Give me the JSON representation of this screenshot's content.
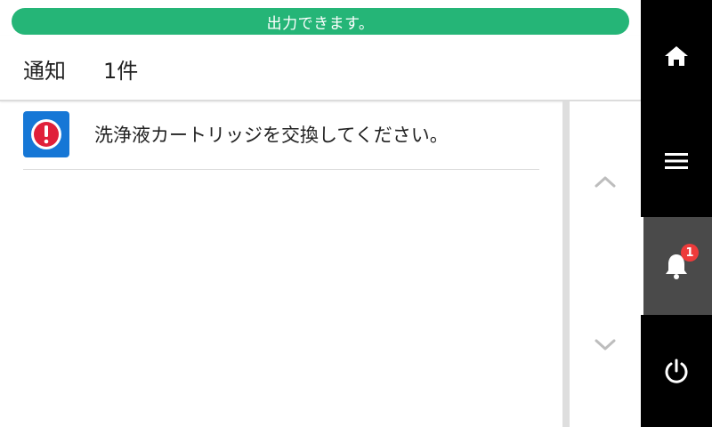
{
  "status": {
    "message": "出力できます。",
    "color": "#25b577"
  },
  "header": {
    "title": "通知",
    "count": "1件"
  },
  "notifications": [
    {
      "icon": "error-icon",
      "text": "洗浄液カートリッジを交換してください。"
    }
  ],
  "scroll": {
    "up_icon": "chevron-up-icon",
    "down_icon": "chevron-down-icon"
  },
  "sidebar": {
    "items": [
      {
        "icon": "home-icon"
      },
      {
        "icon": "menu-icon"
      },
      {
        "icon": "bell-icon",
        "badge": "1",
        "active": true
      },
      {
        "icon": "power-icon"
      }
    ]
  },
  "colors": {
    "accent": "#1677d6",
    "error": "#e0203a",
    "badge": "#ee3b3b",
    "sidebar": "#000000",
    "active": "#4a4a4a"
  }
}
